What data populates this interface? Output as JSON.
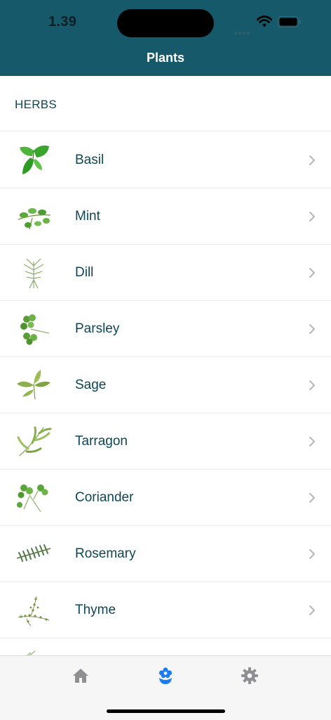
{
  "status_bar": {
    "time": "1.39"
  },
  "nav": {
    "title": "Plants"
  },
  "section": {
    "label": "HERBS"
  },
  "items": [
    {
      "label": "Basil",
      "icon": "basil-icon"
    },
    {
      "label": "Mint",
      "icon": "mint-icon"
    },
    {
      "label": "Dill",
      "icon": "dill-icon"
    },
    {
      "label": "Parsley",
      "icon": "parsley-icon"
    },
    {
      "label": "Sage",
      "icon": "sage-icon"
    },
    {
      "label": "Tarragon",
      "icon": "tarragon-icon"
    },
    {
      "label": "Coriander",
      "icon": "coriander-icon"
    },
    {
      "label": "Rosemary",
      "icon": "rosemary-icon"
    },
    {
      "label": "Thyme",
      "icon": "thyme-icon"
    }
  ],
  "tabbar": {
    "tabs": [
      {
        "icon": "home-icon",
        "selected": false
      },
      {
        "icon": "plant-icon",
        "selected": true
      },
      {
        "icon": "gear-icon",
        "selected": false
      }
    ]
  },
  "colors": {
    "header": "#15596a",
    "text": "#0e4654",
    "tab_active": "#1d7cf2",
    "tab_inactive": "#8e8e93"
  }
}
